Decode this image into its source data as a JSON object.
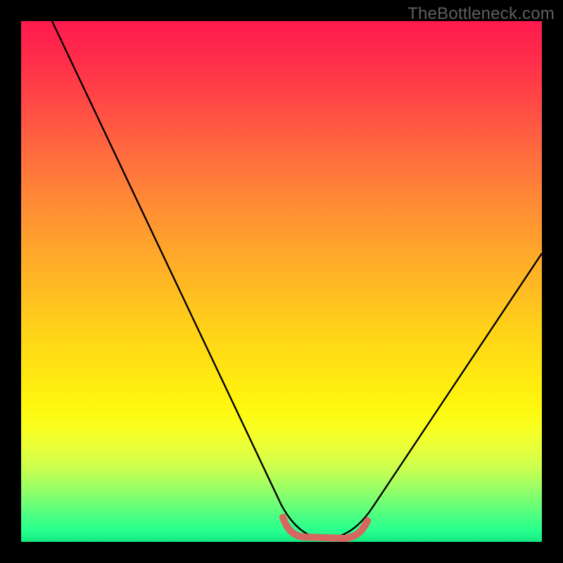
{
  "watermark": {
    "text": "TheBottleneck.com"
  },
  "colors": {
    "curve_stroke": "#000000",
    "highlight_stroke": "#d6665f",
    "background": "#000000"
  },
  "chart_data": {
    "type": "line",
    "title": "",
    "xlabel": "",
    "ylabel": "",
    "xlim": [
      0,
      100
    ],
    "ylim": [
      0,
      100
    ],
    "grid": false,
    "legend": false,
    "series": [
      {
        "name": "bottleneck_curve",
        "x": [
          6,
          10,
          15,
          20,
          25,
          30,
          35,
          40,
          45,
          48,
          50,
          53,
          56,
          59,
          62,
          65,
          68,
          72,
          76,
          80,
          84,
          88,
          92,
          96,
          100
        ],
        "y": [
          100,
          93,
          84.5,
          76,
          67.5,
          59,
          50.5,
          42,
          33,
          26,
          19,
          11,
          5,
          2,
          1,
          1,
          2,
          6,
          13,
          21,
          29,
          37,
          44,
          50.5,
          56
        ]
      },
      {
        "name": "optimal_range_highlight",
        "x": [
          51,
          53,
          56,
          59,
          62,
          65,
          67
        ],
        "y": [
          3.2,
          2.0,
          1.3,
          1.0,
          1.0,
          1.4,
          2.6
        ]
      }
    ],
    "annotations": [
      {
        "text": "TheBottleneck.com",
        "position": "top-right"
      }
    ]
  }
}
